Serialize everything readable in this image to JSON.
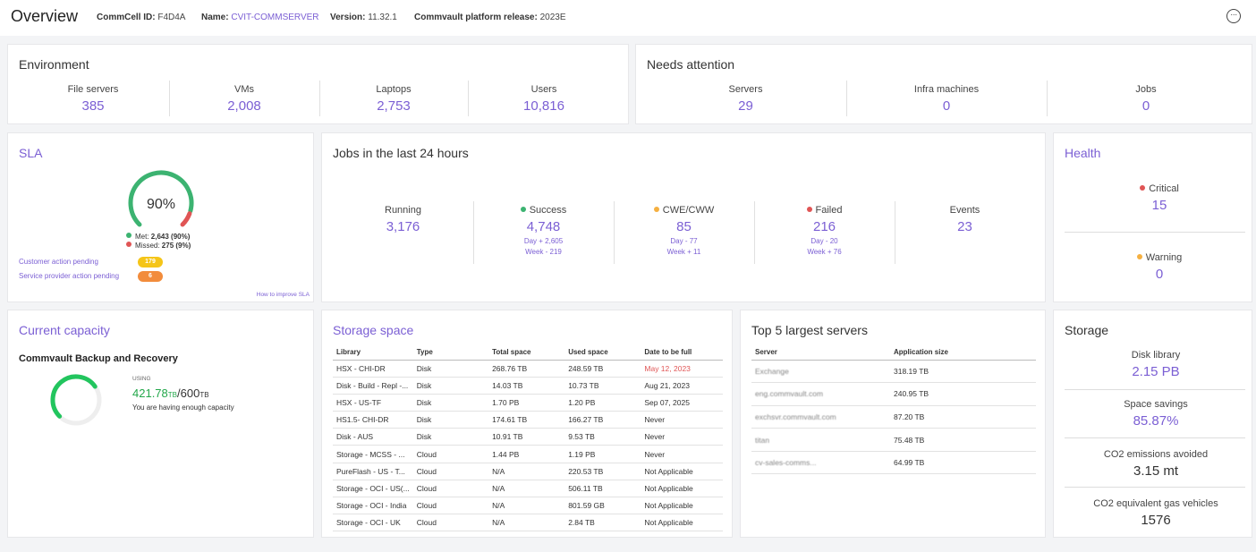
{
  "header": {
    "title": "Overview",
    "commcell_label": "CommCell ID:",
    "commcell_value": "F4D4A",
    "name_label": "Name:",
    "name_value": "CVIT-COMMSERVER",
    "version_label": "Version:",
    "version_value": "11.32.1",
    "release_label": "Commvault platform release:",
    "release_value": "2023E",
    "more_icon": "ellipsis-circle-icon"
  },
  "environment": {
    "title": "Environment",
    "stats": [
      {
        "label": "File servers",
        "value": "385"
      },
      {
        "label": "VMs",
        "value": "2,008"
      },
      {
        "label": "Laptops",
        "value": "2,753"
      },
      {
        "label": "Users",
        "value": "10,816"
      }
    ]
  },
  "attention": {
    "title": "Needs attention",
    "stats": [
      {
        "label": "Servers",
        "value": "29"
      },
      {
        "label": "Infra machines",
        "value": "0"
      },
      {
        "label": "Jobs",
        "value": "0"
      }
    ]
  },
  "sla": {
    "title": "SLA",
    "percent": "90%",
    "percent_value": 90,
    "met_label": "Met:",
    "met_value": "2,643 (90%)",
    "missed_label": "Missed:",
    "missed_value": "275 (9%)",
    "customer_pending_label": "Customer action pending",
    "customer_pending_value": "179",
    "provider_pending_label": "Service provider action pending",
    "provider_pending_value": "6",
    "improve_link": "How to improve SLA",
    "colors": {
      "met": "#3cb371",
      "missed": "#e05555",
      "customer": "#f5c518",
      "provider": "#f28c3c"
    }
  },
  "jobs": {
    "title": "Jobs in the last 24 hours",
    "columns": [
      {
        "label": "Running",
        "value": "3,176",
        "dot": "",
        "day": "",
        "week": ""
      },
      {
        "label": "Success",
        "value": "4,748",
        "dot": "#3cb371",
        "day": "Day + 2,605",
        "week": "Week - 219"
      },
      {
        "label": "CWE/CWW",
        "value": "85",
        "dot": "#f5b041",
        "day": "Day - 77",
        "week": "Week + 11"
      },
      {
        "label": "Failed",
        "value": "216",
        "dot": "#e05555",
        "day": "Day - 20",
        "week": "Week + 76"
      },
      {
        "label": "Events",
        "value": "23",
        "dot": "",
        "day": "",
        "week": ""
      }
    ]
  },
  "health": {
    "title": "Health",
    "critical_label": "Critical",
    "critical_value": "15",
    "warning_label": "Warning",
    "warning_value": "0"
  },
  "capacity": {
    "title": "Current capacity",
    "subtitle": "Commvault Backup and Recovery",
    "using_label": "USING",
    "used": "421.78",
    "used_unit": "TB",
    "total": "/600",
    "total_unit": "TB",
    "message": "You are having enough capacity",
    "used_fraction": 0.703
  },
  "storage_space": {
    "title": "Storage space",
    "headers": [
      "Library",
      "Type",
      "Total space",
      "Used space",
      "Date to be full"
    ],
    "rows": [
      [
        "HSX - CHI-DR",
        "Disk",
        "268.76 TB",
        "248.59 TB",
        "May 12, 2023"
      ],
      [
        "Disk - Build - Repl -...",
        "Disk",
        "14.03 TB",
        "10.73 TB",
        "Aug 21, 2023"
      ],
      [
        "HSX - US-TF",
        "Disk",
        "1.70 PB",
        "1.20 PB",
        "Sep 07, 2025"
      ],
      [
        "HS1.5- CHI-DR",
        "Disk",
        "174.61 TB",
        "166.27 TB",
        "Never"
      ],
      [
        "Disk - AUS",
        "Disk",
        "10.91 TB",
        "9.53 TB",
        "Never"
      ],
      [
        "Storage - MCSS - ...",
        "Cloud",
        "1.44 PB",
        "1.19 PB",
        "Never"
      ],
      [
        "PureFlash - US - T...",
        "Cloud",
        "N/A",
        "220.53 TB",
        "Not Applicable"
      ],
      [
        "Storage - OCI - US(...",
        "Cloud",
        "N/A",
        "506.11 TB",
        "Not Applicable"
      ],
      [
        "Storage - OCI - India",
        "Cloud",
        "N/A",
        "801.59 GB",
        "Not Applicable"
      ],
      [
        "Storage - OCI - UK",
        "Cloud",
        "N/A",
        "2.84 TB",
        "Not Applicable"
      ]
    ]
  },
  "top_servers": {
    "title": "Top 5 largest servers",
    "headers": [
      "Server",
      "Application size"
    ],
    "rows": [
      [
        "Exchange",
        "318.19 TB"
      ],
      [
        "eng.commvault.com",
        "240.95 TB"
      ],
      [
        "exchsvr.commvault.com",
        "87.20 TB"
      ],
      [
        "titan",
        "75.48 TB"
      ],
      [
        "cv-sales-comms...",
        "64.99 TB"
      ]
    ]
  },
  "storage": {
    "title": "Storage",
    "items": [
      {
        "label": "Disk library",
        "value": "2.15 PB"
      },
      {
        "label": "Space savings",
        "value": "85.87%"
      },
      {
        "label": "CO2 emissions avoided",
        "value": "3.15 mt"
      },
      {
        "label": "CO2 equivalent gas vehicles",
        "value": "1576"
      }
    ]
  }
}
